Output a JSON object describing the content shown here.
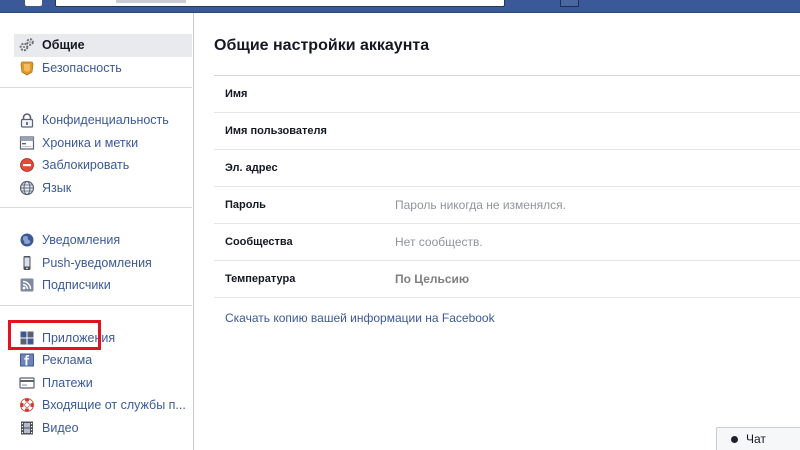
{
  "sidebar": {
    "groups": [
      {
        "items": [
          {
            "label": "Общие",
            "icon": "gears-icon",
            "active": true
          },
          {
            "label": "Безопасность",
            "icon": "shield-icon"
          }
        ]
      },
      {
        "items": [
          {
            "label": "Конфиденциальность",
            "icon": "lock-icon"
          },
          {
            "label": "Хроника и метки",
            "icon": "timeline-icon"
          },
          {
            "label": "Заблокировать",
            "icon": "block-icon"
          },
          {
            "label": "Язык",
            "icon": "globe-icon"
          }
        ]
      },
      {
        "items": [
          {
            "label": "Уведомления",
            "icon": "globe-notification-icon"
          },
          {
            "label": "Push-уведомления",
            "icon": "phone-icon"
          },
          {
            "label": "Подписчики",
            "icon": "rss-icon"
          }
        ]
      },
      {
        "items": [
          {
            "label": "Приложения",
            "icon": "apps-icon"
          },
          {
            "label": "Реклама",
            "icon": "ads-icon"
          },
          {
            "label": "Платежи",
            "icon": "card-icon"
          },
          {
            "label": "Входящие от службы п...",
            "icon": "lifebuoy-icon"
          },
          {
            "label": "Видео",
            "icon": "film-icon"
          }
        ]
      }
    ]
  },
  "main": {
    "title": "Общие настройки аккаунта",
    "rows": [
      {
        "key": "Имя",
        "value": ""
      },
      {
        "key": "Имя пользователя",
        "value": ""
      },
      {
        "key": "Эл. адрес",
        "value": ""
      },
      {
        "key": "Пароль",
        "value": "Пароль никогда не изменялся."
      },
      {
        "key": "Сообщества",
        "value": "Нет сообществ."
      },
      {
        "key": "Температура",
        "value": "По Цельсию"
      }
    ],
    "download_link": "Скачать копию",
    "download_suffix": " вашей информации на Facebook"
  },
  "chat": {
    "label": "Чат"
  },
  "colors": {
    "brand": "#3b5998",
    "highlight": "#e0141e"
  }
}
